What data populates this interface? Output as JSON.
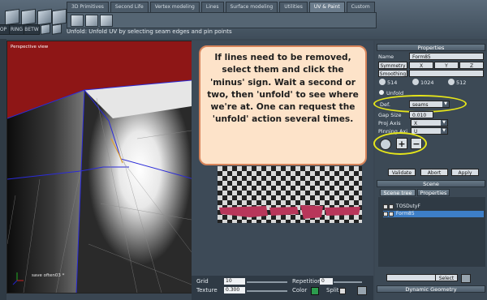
{
  "toolbar": {
    "mode_buttons": [
      "OP",
      "RING",
      "BETW"
    ],
    "tabs": [
      {
        "label": "3D Primitives",
        "active": false
      },
      {
        "label": "Second Life",
        "active": false
      },
      {
        "label": "Vertex modeling",
        "active": false
      },
      {
        "label": "Lines",
        "active": false
      },
      {
        "label": "Surface modeling",
        "active": false
      },
      {
        "label": "Utilities",
        "active": false
      },
      {
        "label": "UV & Paint",
        "active": true
      },
      {
        "label": "Custom",
        "active": false
      }
    ],
    "status": "Unfold: Unfold UV by selecting seam edges and pin points"
  },
  "viewport": {
    "label": "Perspective view",
    "file_label": "save often03 *"
  },
  "callout": {
    "text": "If lines need to be removed, select them and click the 'minus' sign. Wait a second or two, then 'unfold' to see where we're at. One can request the 'unfold' action several times."
  },
  "bottom": {
    "grid_label": "Grid",
    "grid_value": "10",
    "texture_label": "Texture",
    "texture_value": "0.300",
    "repetition_label": "Repetition",
    "repetition_value": "0",
    "color_label": "Color",
    "split_label": "Split"
  },
  "properties": {
    "header": "Properties",
    "name_label": "Name",
    "name_value": "Form85",
    "symmetry_label": "Symmetry",
    "axes": [
      "X",
      "Y",
      "Z"
    ],
    "smoothing_label": "Smoothing",
    "res_values": [
      "514",
      "1024",
      "512"
    ],
    "unfold_label": "Unfold",
    "def_label": "Def.",
    "def_value": "seams",
    "gap_label": "Gap Size",
    "gap_value": "0.010",
    "proj_label": "Proj Axis",
    "proj_value": "X",
    "pin_label": "Pinning Axi",
    "pin_value": "U",
    "plus": "+",
    "minus": "−",
    "validate": "Validate",
    "abort": "Abort",
    "apply": "Apply"
  },
  "scene": {
    "header": "Scene",
    "tabs": [
      "Scene tree",
      "Properties"
    ],
    "items": [
      "TOSDutyF",
      "Form85"
    ],
    "select_label": "Select",
    "footer": "Dynamic Geometry"
  },
  "colors": {
    "callout_bg": "#fde3c9",
    "callout_border": "#d7845a",
    "highlight": "#e5e51a",
    "selected_row": "#3d7ec7"
  }
}
